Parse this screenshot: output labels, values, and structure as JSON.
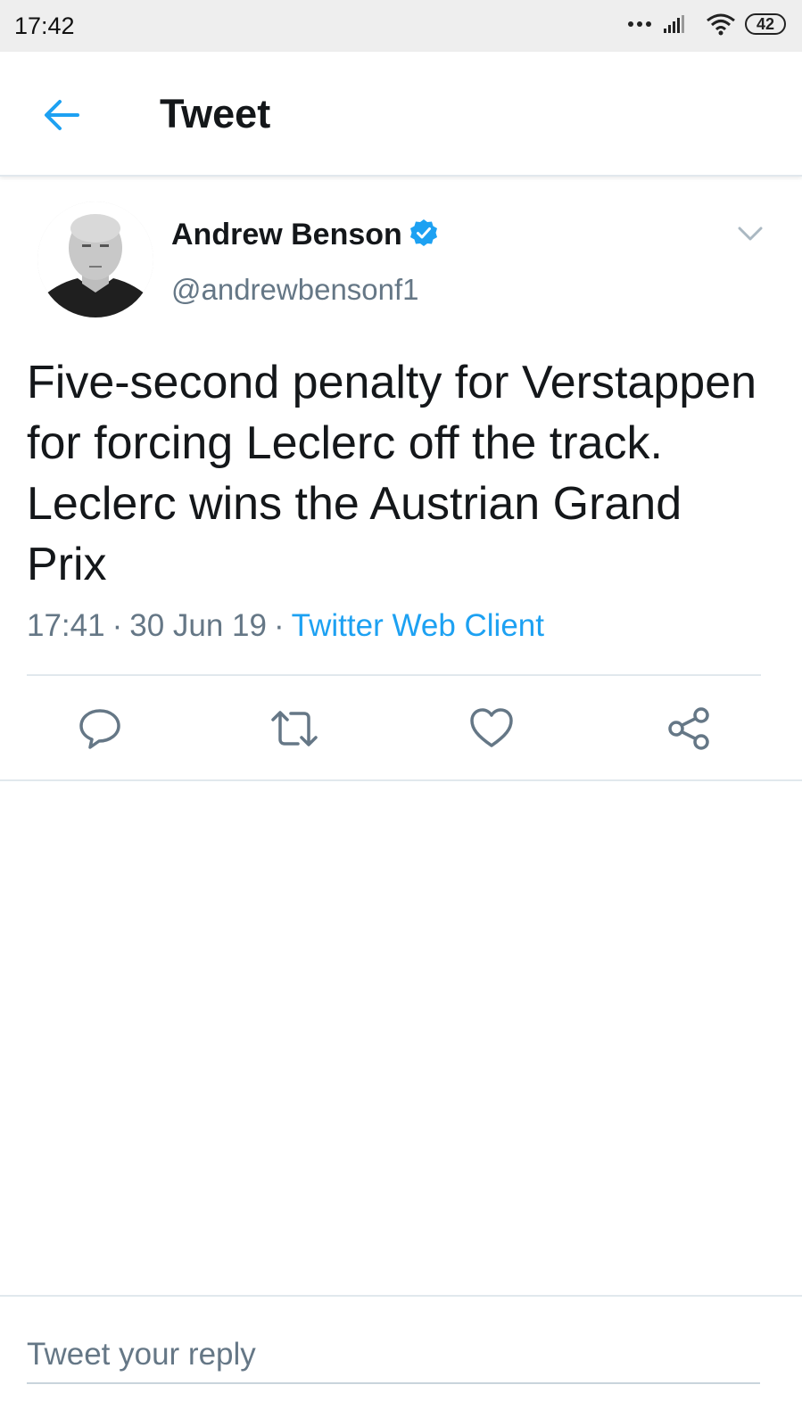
{
  "status_bar": {
    "time": "17:42",
    "battery": "42"
  },
  "header": {
    "back_icon": "arrow-left-icon",
    "title": "Tweet"
  },
  "tweet": {
    "author": {
      "name": "Andrew Benson",
      "handle": "@andrewbensonf1",
      "verified": true
    },
    "text": "Five-second penalty for Verstappen for forcing Leclerc off the track. Leclerc wins the Austrian Grand Prix",
    "time": "17:41",
    "date": "30 Jun 19",
    "separator": "·",
    "client": "Twitter Web Client",
    "actions": [
      {
        "name": "reply",
        "icon": "comment-icon"
      },
      {
        "name": "retweet",
        "icon": "retweet-icon"
      },
      {
        "name": "like",
        "icon": "heart-icon"
      },
      {
        "name": "share",
        "icon": "share-icon"
      }
    ]
  },
  "reply_box": {
    "placeholder": "Tweet your reply"
  },
  "colors": {
    "accent": "#1da1f2",
    "text_primary": "#14171a",
    "text_secondary": "#657786",
    "divider": "#e1e8ed",
    "status_bar_bg": "#eeeeee"
  }
}
